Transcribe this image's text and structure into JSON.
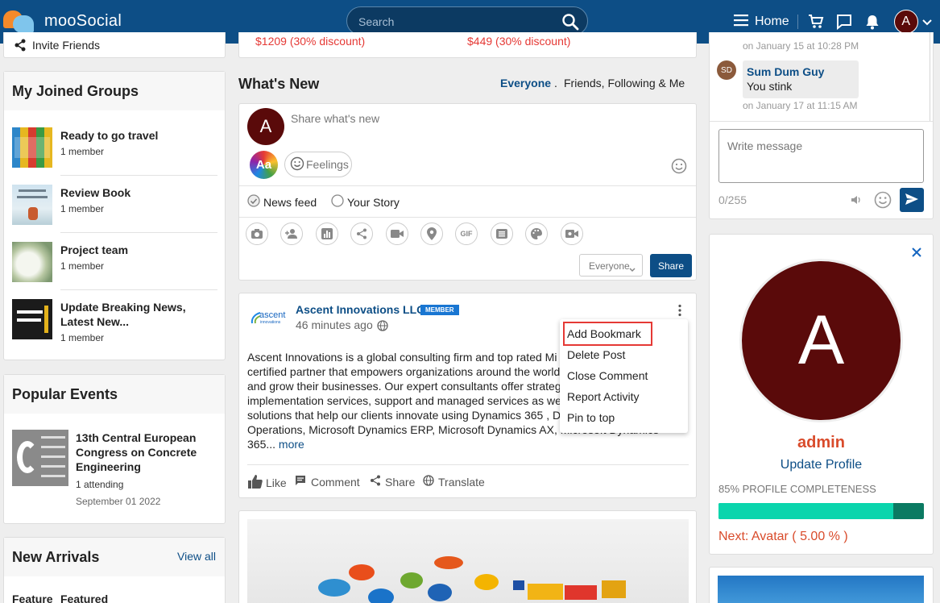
{
  "topbar": {
    "app_name": "mooSocial",
    "search_placeholder": "Search",
    "home_label": "Home",
    "avatar_initial": "A"
  },
  "left": {
    "invite_label": "Invite Friends",
    "groups_title": "My Joined Groups",
    "groups": [
      {
        "title": "Ready to go travel",
        "meta": "1 member"
      },
      {
        "title": "Review Book",
        "meta": "1 member"
      },
      {
        "title": "Project team",
        "meta": "1 member"
      },
      {
        "title": "Update Breaking News, Latest New...",
        "meta": "1 member"
      }
    ],
    "events_title": "Popular Events",
    "event": {
      "title": "13th Central European Congress on Concrete Engineering",
      "attending": "1 attending",
      "date": "September 01 2022"
    },
    "arrivals_title": "New Arrivals",
    "arrivals_view_all": "View all",
    "arrivals_tabs": [
      "Feature",
      "Featured"
    ]
  },
  "top_clip": {
    "price_left": "$1209 (30% discount)",
    "price_right": "$449 (30% discount)"
  },
  "feed": {
    "title": "What's New",
    "filter_everyone": "Everyone",
    "filter_sep": ".",
    "filter_friends": "Friends, Following & Me",
    "composer": {
      "avatar_initial": "A",
      "placeholder": "Share what's new",
      "aa_label": "Aa",
      "feelings_label": "Feelings",
      "newsfeed_label": "News feed",
      "story_label": "Your Story",
      "gif_label": "GIF",
      "privacy_value": "Everyone",
      "share_label": "Share"
    },
    "post": {
      "author": "Ascent Innovations LLC",
      "badge": "MEMBER",
      "logo_text": "ascent",
      "logo_sub": "innovations",
      "time": "46 minutes ago",
      "lines": [
        "Ascent Innovations is a global consulting firm and top rated Mi",
        "certified partner that empowers organizations around the world",
        "and grow their businesses. Our expert consultants offer strateg",
        "implementation services, support and managed services as we",
        "solutions that help our clients innovate using Dynamics 365 , D",
        "Operations, Microsoft Dynamics ERP, Microsoft Dynamics AX, Microsoft Dynamics",
        "365..."
      ],
      "more_label": "more",
      "actions": {
        "like": "Like",
        "comment": "Comment",
        "share": "Share",
        "translate": "Translate"
      }
    },
    "menu": [
      "Add Bookmark",
      "Delete Post",
      "Close Comment",
      "Report Activity",
      "Pin to top"
    ]
  },
  "chat": {
    "prev_time": "on January 15 at 10:28 PM",
    "msg": {
      "avatar": "SD",
      "name": "Sum Dum Guy",
      "text": "You stink",
      "time": "on January 17 at 11:15 AM"
    },
    "input_placeholder": "Write message",
    "counter": "0/255"
  },
  "profile": {
    "avatar_initial": "A",
    "name": "admin",
    "update_label": "Update Profile",
    "completeness_label": "85% PROFILE COMPLETENESS",
    "progress": 0.85,
    "next_label": "Next: Avatar ( 5.00 % )"
  },
  "colors": {
    "topbar": "#0d4e86",
    "accent": "#0d4e86",
    "admin": "#d94b2b",
    "progress": "#0ad5ad",
    "highlight": "#e53935"
  }
}
